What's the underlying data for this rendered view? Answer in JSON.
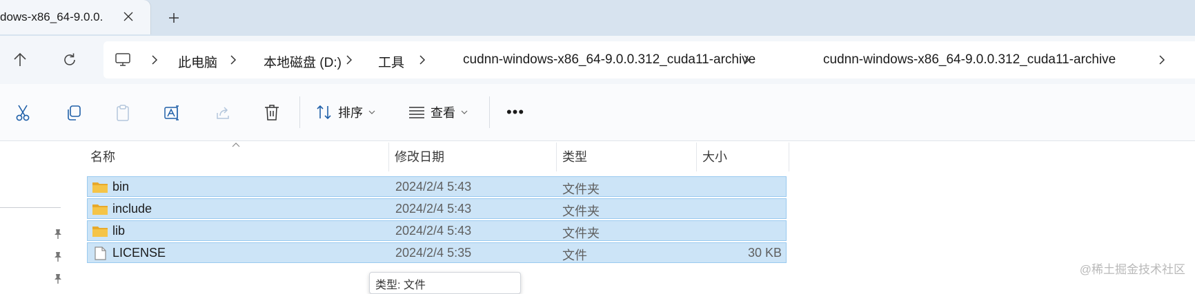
{
  "tab": {
    "title": "dows-x86_64-9.0.0."
  },
  "breadcrumbs": [
    "此电脑",
    "本地磁盘 (D:)",
    "工具",
    "cudnn-windows-x86_64-9.0.0.312_cuda11-archive",
    "cudnn-windows-x86_64-9.0.0.312_cuda11-archive"
  ],
  "toolbar": {
    "icons": [
      "cut-icon",
      "copy-icon",
      "paste-icon",
      "rename-icon",
      "share-icon",
      "delete-icon"
    ],
    "sort_label": "排序",
    "view_label": "查看",
    "more_label": "•••"
  },
  "columns": {
    "name": "名称",
    "date": "修改日期",
    "type": "类型",
    "size": "大小"
  },
  "files": [
    {
      "name": "bin",
      "date": "2024/2/4 5:43",
      "type": "文件夹",
      "size": "",
      "icon": "folder-icon"
    },
    {
      "name": "include",
      "date": "2024/2/4 5:43",
      "type": "文件夹",
      "size": "",
      "icon": "folder-icon"
    },
    {
      "name": "lib",
      "date": "2024/2/4 5:43",
      "type": "文件夹",
      "size": "",
      "icon": "folder-icon"
    },
    {
      "name": "LICENSE",
      "date": "2024/2/4 5:35",
      "type": "文件",
      "size": "30 KB",
      "icon": "file-icon"
    }
  ],
  "tooltip": "类型: 文件",
  "watermark": "@稀土掘金技术社区",
  "colors": {
    "selection": "#cce4f7",
    "selection_border": "#99c9ef",
    "tab_strip": "#d7e3ef",
    "folder": "#f5c447"
  }
}
